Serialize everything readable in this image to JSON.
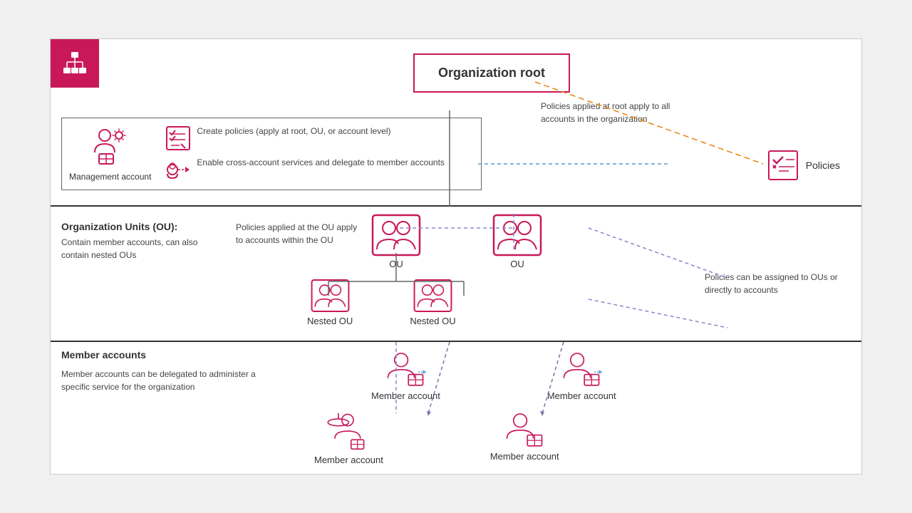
{
  "app": {
    "icon_alt": "AWS Organizations icon"
  },
  "sections": {
    "root": {
      "title": "Organization root",
      "management_label": "Management account",
      "actions": [
        {
          "text": "Create policies (apply at root, OU, or account level)"
        },
        {
          "text": "Enable cross-account services and delegate to member accounts"
        }
      ],
      "policies_label": "Policies",
      "root_note": "Policies applied at root apply to all accounts in the organization"
    },
    "ou": {
      "title": "Organization Units (OU):",
      "desc": "Contain member accounts, can also contain nested OUs",
      "note": "Policies applied at the OU apply to accounts within the OU",
      "ou_items": [
        {
          "label": "OU"
        },
        {
          "label": "OU"
        }
      ],
      "nested_items": [
        {
          "label": "Nested OU"
        },
        {
          "label": "Nested OU"
        }
      ],
      "policies_note": "Policies can be assigned to OUs or directly to accounts"
    },
    "members": {
      "title": "Member accounts",
      "desc": "Member accounts can be delegated to administer a specific service for the organization",
      "accounts_row1": [
        {
          "label": "Member account"
        },
        {
          "label": "Member account"
        }
      ],
      "accounts_row2": [
        {
          "label": "Member account"
        },
        {
          "label": "Member account"
        }
      ]
    }
  }
}
